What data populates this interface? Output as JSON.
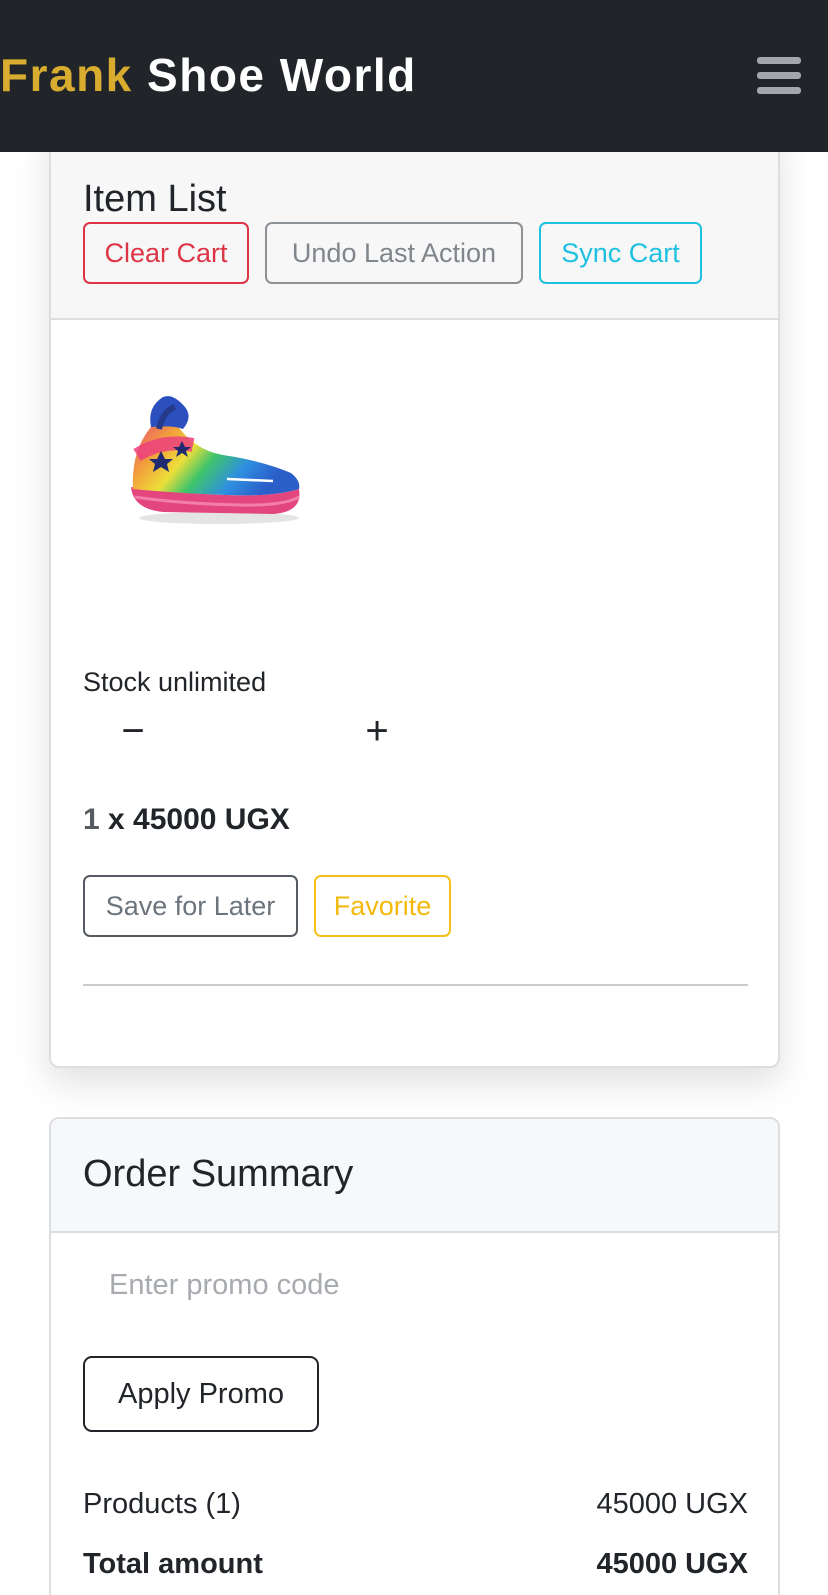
{
  "navbar": {
    "brand_first": "Frank",
    "brand_rest": "Shoe World",
    "menu_icon": "hamburger-menu-icon"
  },
  "item_list": {
    "title": "Item List",
    "buttons": {
      "clear_cart": "Clear Cart",
      "undo_last_action": "Undo Last Action",
      "sync_cart": "Sync Cart"
    },
    "item": {
      "image_icon": "pink-rainbow-sneaker-image",
      "stock": "Stock unlimited",
      "decrement_symbol": "−",
      "increment_symbol": "+",
      "quantity": "1",
      "price_text": " x 45000 UGX",
      "save_for_later": "Save for Later",
      "favorite": "Favorite"
    }
  },
  "order_summary": {
    "title": "Order Summary",
    "promo_placeholder": "Enter promo code",
    "promo_value": "",
    "apply_promo": "Apply Promo",
    "products_label": "Products (1)",
    "products_value": "45000 UGX",
    "total_label": "Total amount",
    "total_value": "45000 UGX"
  },
  "colors": {
    "navbar_bg": "#212529",
    "brand_accent": "#d8ac2f",
    "danger": "#dc3545",
    "secondary": "#6c757d",
    "info": "#1fc0e0",
    "warning": "#f3b90d"
  }
}
